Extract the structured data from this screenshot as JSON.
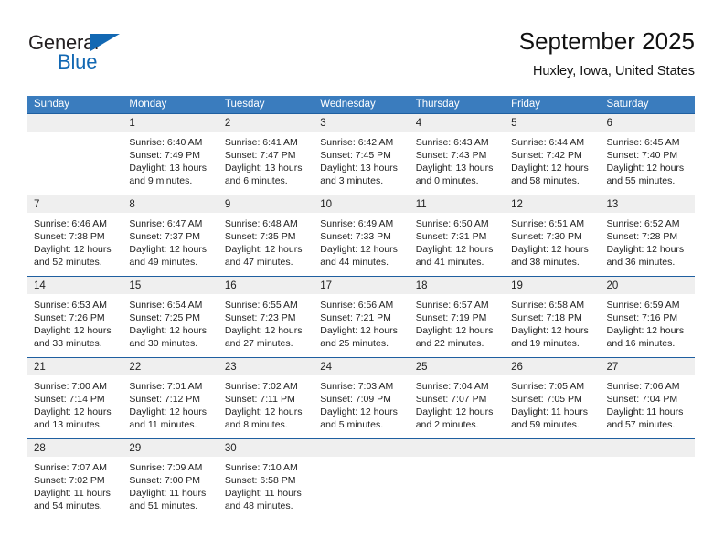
{
  "brand": {
    "name_top": "General",
    "name_bottom": "Blue",
    "triangle_color": "#1268b3",
    "text_color": "#231f20"
  },
  "header": {
    "title": "September 2025",
    "subtitle": "Huxley, Iowa, United States"
  },
  "theme": {
    "header_bg": "#3a7cbe",
    "header_text": "#ffffff",
    "week_rule": "#1f5fa0",
    "daynum_band": "#efefef",
    "body_text": "#222222"
  },
  "weekdays": [
    "Sunday",
    "Monday",
    "Tuesday",
    "Wednesday",
    "Thursday",
    "Friday",
    "Saturday"
  ],
  "weeks": [
    {
      "days": [
        {
          "num": "",
          "sunrise": "",
          "sunset": "",
          "daylight_1": "",
          "daylight_2": ""
        },
        {
          "num": "1",
          "sunrise": "Sunrise: 6:40 AM",
          "sunset": "Sunset: 7:49 PM",
          "daylight_1": "Daylight: 13 hours",
          "daylight_2": "and 9 minutes."
        },
        {
          "num": "2",
          "sunrise": "Sunrise: 6:41 AM",
          "sunset": "Sunset: 7:47 PM",
          "daylight_1": "Daylight: 13 hours",
          "daylight_2": "and 6 minutes."
        },
        {
          "num": "3",
          "sunrise": "Sunrise: 6:42 AM",
          "sunset": "Sunset: 7:45 PM",
          "daylight_1": "Daylight: 13 hours",
          "daylight_2": "and 3 minutes."
        },
        {
          "num": "4",
          "sunrise": "Sunrise: 6:43 AM",
          "sunset": "Sunset: 7:43 PM",
          "daylight_1": "Daylight: 13 hours",
          "daylight_2": "and 0 minutes."
        },
        {
          "num": "5",
          "sunrise": "Sunrise: 6:44 AM",
          "sunset": "Sunset: 7:42 PM",
          "daylight_1": "Daylight: 12 hours",
          "daylight_2": "and 58 minutes."
        },
        {
          "num": "6",
          "sunrise": "Sunrise: 6:45 AM",
          "sunset": "Sunset: 7:40 PM",
          "daylight_1": "Daylight: 12 hours",
          "daylight_2": "and 55 minutes."
        }
      ]
    },
    {
      "days": [
        {
          "num": "7",
          "sunrise": "Sunrise: 6:46 AM",
          "sunset": "Sunset: 7:38 PM",
          "daylight_1": "Daylight: 12 hours",
          "daylight_2": "and 52 minutes."
        },
        {
          "num": "8",
          "sunrise": "Sunrise: 6:47 AM",
          "sunset": "Sunset: 7:37 PM",
          "daylight_1": "Daylight: 12 hours",
          "daylight_2": "and 49 minutes."
        },
        {
          "num": "9",
          "sunrise": "Sunrise: 6:48 AM",
          "sunset": "Sunset: 7:35 PM",
          "daylight_1": "Daylight: 12 hours",
          "daylight_2": "and 47 minutes."
        },
        {
          "num": "10",
          "sunrise": "Sunrise: 6:49 AM",
          "sunset": "Sunset: 7:33 PM",
          "daylight_1": "Daylight: 12 hours",
          "daylight_2": "and 44 minutes."
        },
        {
          "num": "11",
          "sunrise": "Sunrise: 6:50 AM",
          "sunset": "Sunset: 7:31 PM",
          "daylight_1": "Daylight: 12 hours",
          "daylight_2": "and 41 minutes."
        },
        {
          "num": "12",
          "sunrise": "Sunrise: 6:51 AM",
          "sunset": "Sunset: 7:30 PM",
          "daylight_1": "Daylight: 12 hours",
          "daylight_2": "and 38 minutes."
        },
        {
          "num": "13",
          "sunrise": "Sunrise: 6:52 AM",
          "sunset": "Sunset: 7:28 PM",
          "daylight_1": "Daylight: 12 hours",
          "daylight_2": "and 36 minutes."
        }
      ]
    },
    {
      "days": [
        {
          "num": "14",
          "sunrise": "Sunrise: 6:53 AM",
          "sunset": "Sunset: 7:26 PM",
          "daylight_1": "Daylight: 12 hours",
          "daylight_2": "and 33 minutes."
        },
        {
          "num": "15",
          "sunrise": "Sunrise: 6:54 AM",
          "sunset": "Sunset: 7:25 PM",
          "daylight_1": "Daylight: 12 hours",
          "daylight_2": "and 30 minutes."
        },
        {
          "num": "16",
          "sunrise": "Sunrise: 6:55 AM",
          "sunset": "Sunset: 7:23 PM",
          "daylight_1": "Daylight: 12 hours",
          "daylight_2": "and 27 minutes."
        },
        {
          "num": "17",
          "sunrise": "Sunrise: 6:56 AM",
          "sunset": "Sunset: 7:21 PM",
          "daylight_1": "Daylight: 12 hours",
          "daylight_2": "and 25 minutes."
        },
        {
          "num": "18",
          "sunrise": "Sunrise: 6:57 AM",
          "sunset": "Sunset: 7:19 PM",
          "daylight_1": "Daylight: 12 hours",
          "daylight_2": "and 22 minutes."
        },
        {
          "num": "19",
          "sunrise": "Sunrise: 6:58 AM",
          "sunset": "Sunset: 7:18 PM",
          "daylight_1": "Daylight: 12 hours",
          "daylight_2": "and 19 minutes."
        },
        {
          "num": "20",
          "sunrise": "Sunrise: 6:59 AM",
          "sunset": "Sunset: 7:16 PM",
          "daylight_1": "Daylight: 12 hours",
          "daylight_2": "and 16 minutes."
        }
      ]
    },
    {
      "days": [
        {
          "num": "21",
          "sunrise": "Sunrise: 7:00 AM",
          "sunset": "Sunset: 7:14 PM",
          "daylight_1": "Daylight: 12 hours",
          "daylight_2": "and 13 minutes."
        },
        {
          "num": "22",
          "sunrise": "Sunrise: 7:01 AM",
          "sunset": "Sunset: 7:12 PM",
          "daylight_1": "Daylight: 12 hours",
          "daylight_2": "and 11 minutes."
        },
        {
          "num": "23",
          "sunrise": "Sunrise: 7:02 AM",
          "sunset": "Sunset: 7:11 PM",
          "daylight_1": "Daylight: 12 hours",
          "daylight_2": "and 8 minutes."
        },
        {
          "num": "24",
          "sunrise": "Sunrise: 7:03 AM",
          "sunset": "Sunset: 7:09 PM",
          "daylight_1": "Daylight: 12 hours",
          "daylight_2": "and 5 minutes."
        },
        {
          "num": "25",
          "sunrise": "Sunrise: 7:04 AM",
          "sunset": "Sunset: 7:07 PM",
          "daylight_1": "Daylight: 12 hours",
          "daylight_2": "and 2 minutes."
        },
        {
          "num": "26",
          "sunrise": "Sunrise: 7:05 AM",
          "sunset": "Sunset: 7:05 PM",
          "daylight_1": "Daylight: 11 hours",
          "daylight_2": "and 59 minutes."
        },
        {
          "num": "27",
          "sunrise": "Sunrise: 7:06 AM",
          "sunset": "Sunset: 7:04 PM",
          "daylight_1": "Daylight: 11 hours",
          "daylight_2": "and 57 minutes."
        }
      ]
    },
    {
      "days": [
        {
          "num": "28",
          "sunrise": "Sunrise: 7:07 AM",
          "sunset": "Sunset: 7:02 PM",
          "daylight_1": "Daylight: 11 hours",
          "daylight_2": "and 54 minutes."
        },
        {
          "num": "29",
          "sunrise": "Sunrise: 7:09 AM",
          "sunset": "Sunset: 7:00 PM",
          "daylight_1": "Daylight: 11 hours",
          "daylight_2": "and 51 minutes."
        },
        {
          "num": "30",
          "sunrise": "Sunrise: 7:10 AM",
          "sunset": "Sunset: 6:58 PM",
          "daylight_1": "Daylight: 11 hours",
          "daylight_2": "and 48 minutes."
        },
        {
          "num": "",
          "sunrise": "",
          "sunset": "",
          "daylight_1": "",
          "daylight_2": ""
        },
        {
          "num": "",
          "sunrise": "",
          "sunset": "",
          "daylight_1": "",
          "daylight_2": ""
        },
        {
          "num": "",
          "sunrise": "",
          "sunset": "",
          "daylight_1": "",
          "daylight_2": ""
        },
        {
          "num": "",
          "sunrise": "",
          "sunset": "",
          "daylight_1": "",
          "daylight_2": ""
        }
      ]
    }
  ]
}
